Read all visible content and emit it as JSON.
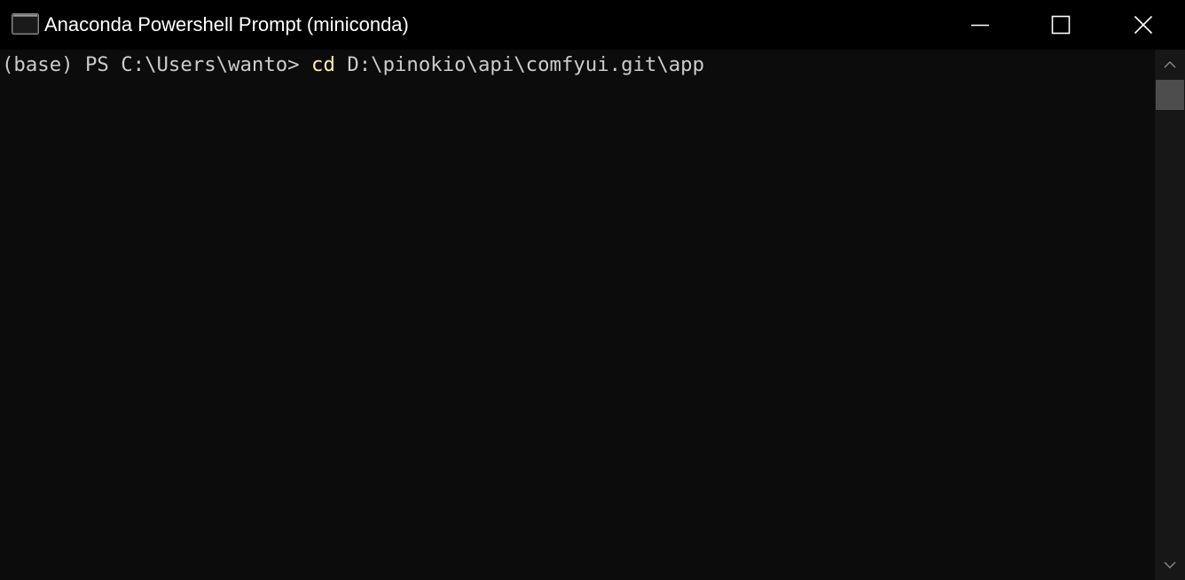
{
  "window": {
    "title": "Anaconda Powershell Prompt (miniconda)",
    "app_icon": "console-icon",
    "controls": {
      "minimize_icon": "minimize-icon",
      "maximize_icon": "maximize-icon",
      "close_icon": "close-icon"
    }
  },
  "console": {
    "lines": [
      {
        "prompt": "(base) PS C:\\Users\\wanto> ",
        "command": "cd",
        "args": " D:\\pinokio\\api\\comfyui.git\\app"
      }
    ]
  },
  "scrollbar": {
    "up_icon": "chevron-up-icon",
    "down_icon": "chevron-down-icon"
  },
  "colors": {
    "background": "#0c0c0c",
    "text": "#cccccc",
    "command": "#f9f1a5",
    "titlebar": "#000000"
  }
}
